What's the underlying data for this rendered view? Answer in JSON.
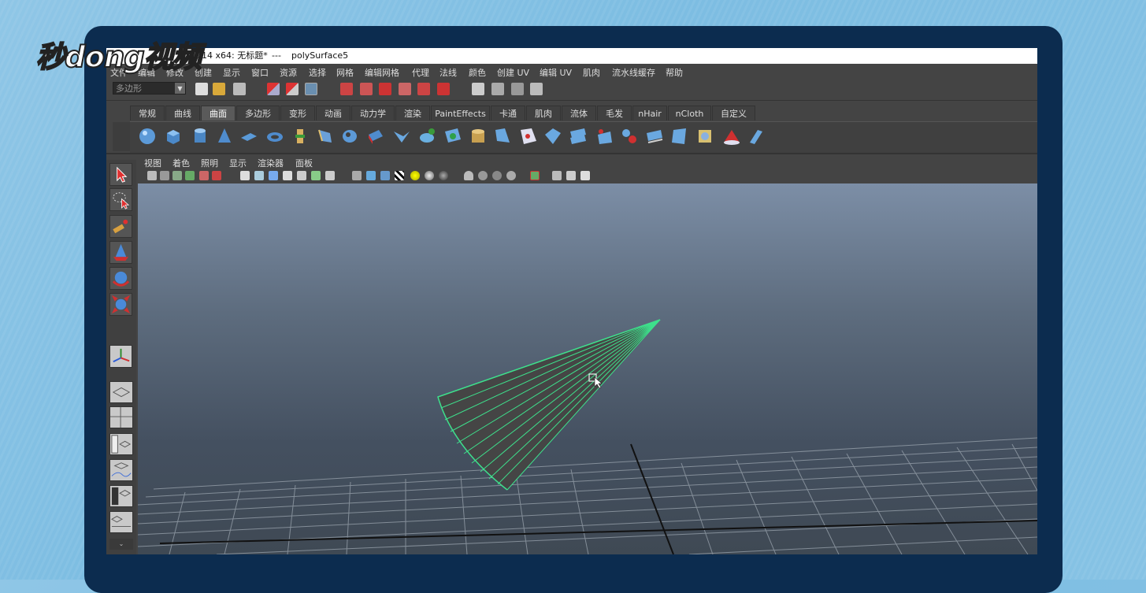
{
  "window": {
    "title_prefix": "014 x64: 无标题*",
    "title_sep": "---",
    "title_object": "polySurface5"
  },
  "menubar": [
    "文件",
    "编辑",
    "修改",
    "创建",
    "显示",
    "窗口",
    "资源",
    "选择",
    "网格",
    "编辑网格",
    "代理",
    "法线",
    "颜色",
    "创建 UV",
    "编辑 UV",
    "肌肉",
    "流水线缓存",
    "帮助"
  ],
  "toolbar": {
    "mode_value": "多边形"
  },
  "shelf_tabs": [
    "常规",
    "曲线",
    "曲面",
    "多边形",
    "变形",
    "动画",
    "动力学",
    "渲染",
    "PaintEffects",
    "卡通",
    "肌肉",
    "流体",
    "毛发",
    "nHair",
    "nCloth",
    "自定义"
  ],
  "shelf_active": "曲面",
  "viewport_menu": [
    "视图",
    "着色",
    "照明",
    "显示",
    "渲染器",
    "面板"
  ],
  "watermark": "秒dong视频",
  "colors": {
    "accent_wire": "#3ee08c",
    "monitor_frame": "#0c2c4f",
    "background": "#8fc6e6"
  },
  "icons": {
    "tools": [
      "select-tool-icon",
      "lasso-tool-icon",
      "paint-select-tool-icon",
      "move-tool-icon",
      "rotate-tool-icon",
      "scale-tool-icon",
      "manipulator-icon"
    ],
    "layouts": [
      "single-pane-layout-icon",
      "four-pane-layout-icon",
      "outliner-persp-layout-icon",
      "graph-persp-layout-icon",
      "hypershade-layout-icon",
      "persp-outliner-layout-icon"
    ]
  }
}
